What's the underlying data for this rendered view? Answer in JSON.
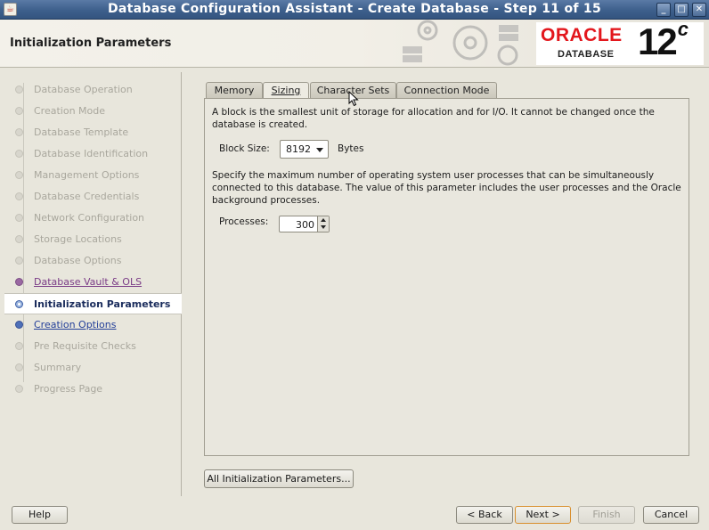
{
  "window": {
    "title": "Database Configuration Assistant - Create Database - Step 11 of 15",
    "controls": [
      "minimize",
      "maximize",
      "close"
    ]
  },
  "header": {
    "page_title": "Initialization Parameters",
    "logo": {
      "brand": "ORACLE",
      "product": "DATABASE",
      "version": "12",
      "version_suffix": "c"
    }
  },
  "steps": [
    {
      "label": "Database Operation",
      "state": "inactive"
    },
    {
      "label": "Creation Mode",
      "state": "inactive"
    },
    {
      "label": "Database Template",
      "state": "inactive"
    },
    {
      "label": "Database Identification",
      "state": "inactive"
    },
    {
      "label": "Management Options",
      "state": "inactive"
    },
    {
      "label": "Database Credentials",
      "state": "inactive"
    },
    {
      "label": "Network Configuration",
      "state": "inactive"
    },
    {
      "label": "Storage Locations",
      "state": "inactive"
    },
    {
      "label": "Database Options",
      "state": "inactive"
    },
    {
      "label": "Database Vault & OLS",
      "state": "visited"
    },
    {
      "label": "Initialization Parameters",
      "state": "current"
    },
    {
      "label": "Creation Options",
      "state": "next"
    },
    {
      "label": "Pre Requisite Checks",
      "state": "inactive"
    },
    {
      "label": "Summary",
      "state": "inactive"
    },
    {
      "label": "Progress Page",
      "state": "inactive"
    }
  ],
  "tabs": [
    {
      "label": "Memory",
      "active": false
    },
    {
      "label": "Sizing",
      "active": true
    },
    {
      "label": "Character Sets",
      "active": false
    },
    {
      "label": "Connection Mode",
      "active": false
    }
  ],
  "sizing": {
    "block_desc": "A block is the smallest unit of storage for allocation and for I/O. It cannot be changed once the database is created.",
    "block_size_label": "Block Size:",
    "block_size_value": "8192",
    "block_size_unit": "Bytes",
    "processes_desc": "Specify the maximum number of operating system user processes that can be simultaneously connected to this database. The value of this parameter includes the user processes and the Oracle background processes.",
    "processes_label": "Processes:",
    "processes_value": "300"
  },
  "buttons": {
    "all_params": "All Initialization Parameters...",
    "help": "Help",
    "back": "< Back",
    "next": "Next >",
    "finish": "Finish",
    "cancel": "Cancel"
  },
  "colors": {
    "title_bar": "#3d5f8c",
    "oracle_red": "#e3171d",
    "visited_step": "#7a3b86",
    "next_step": "#233f99",
    "default_button_border": "#d9902e"
  }
}
